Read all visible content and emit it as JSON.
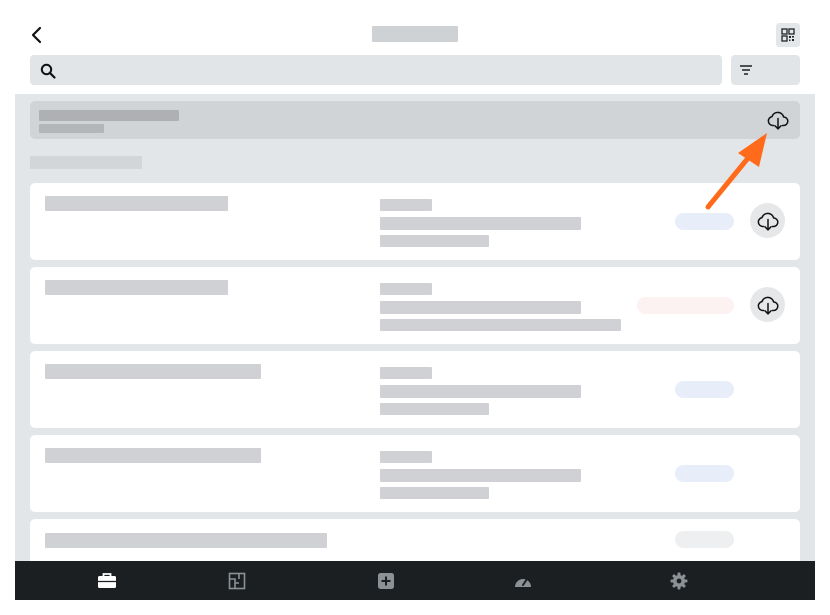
{
  "header": {
    "back_icon": "chevron-left-icon",
    "qr_icon": "qr-code-icon"
  },
  "search": {
    "search_icon": "search-icon",
    "filter_icon": "filter-lines-icon"
  },
  "banner": {
    "download_icon": "cloud-download-icon"
  },
  "cards": [
    {
      "status_color": "#e8edfa",
      "has_download": true
    },
    {
      "status_color": "#fcf2f2",
      "has_download": true
    },
    {
      "status_color": "#e8edfa",
      "has_download": false
    },
    {
      "status_color": "#e8edfa",
      "has_download": false
    },
    {
      "status_color": "#eeeff1",
      "has_download": false
    }
  ],
  "annotation": {
    "arrow_color": "#ff6b1a"
  },
  "bottom_nav": {
    "items": [
      "briefcase-icon",
      "floor-plan-icon",
      "add-square-icon",
      "dashboard-gauge-icon",
      "settings-gear-icon"
    ],
    "active_index": 0,
    "active_color": "#ffffff",
    "inactive_color": "#8c9196"
  }
}
